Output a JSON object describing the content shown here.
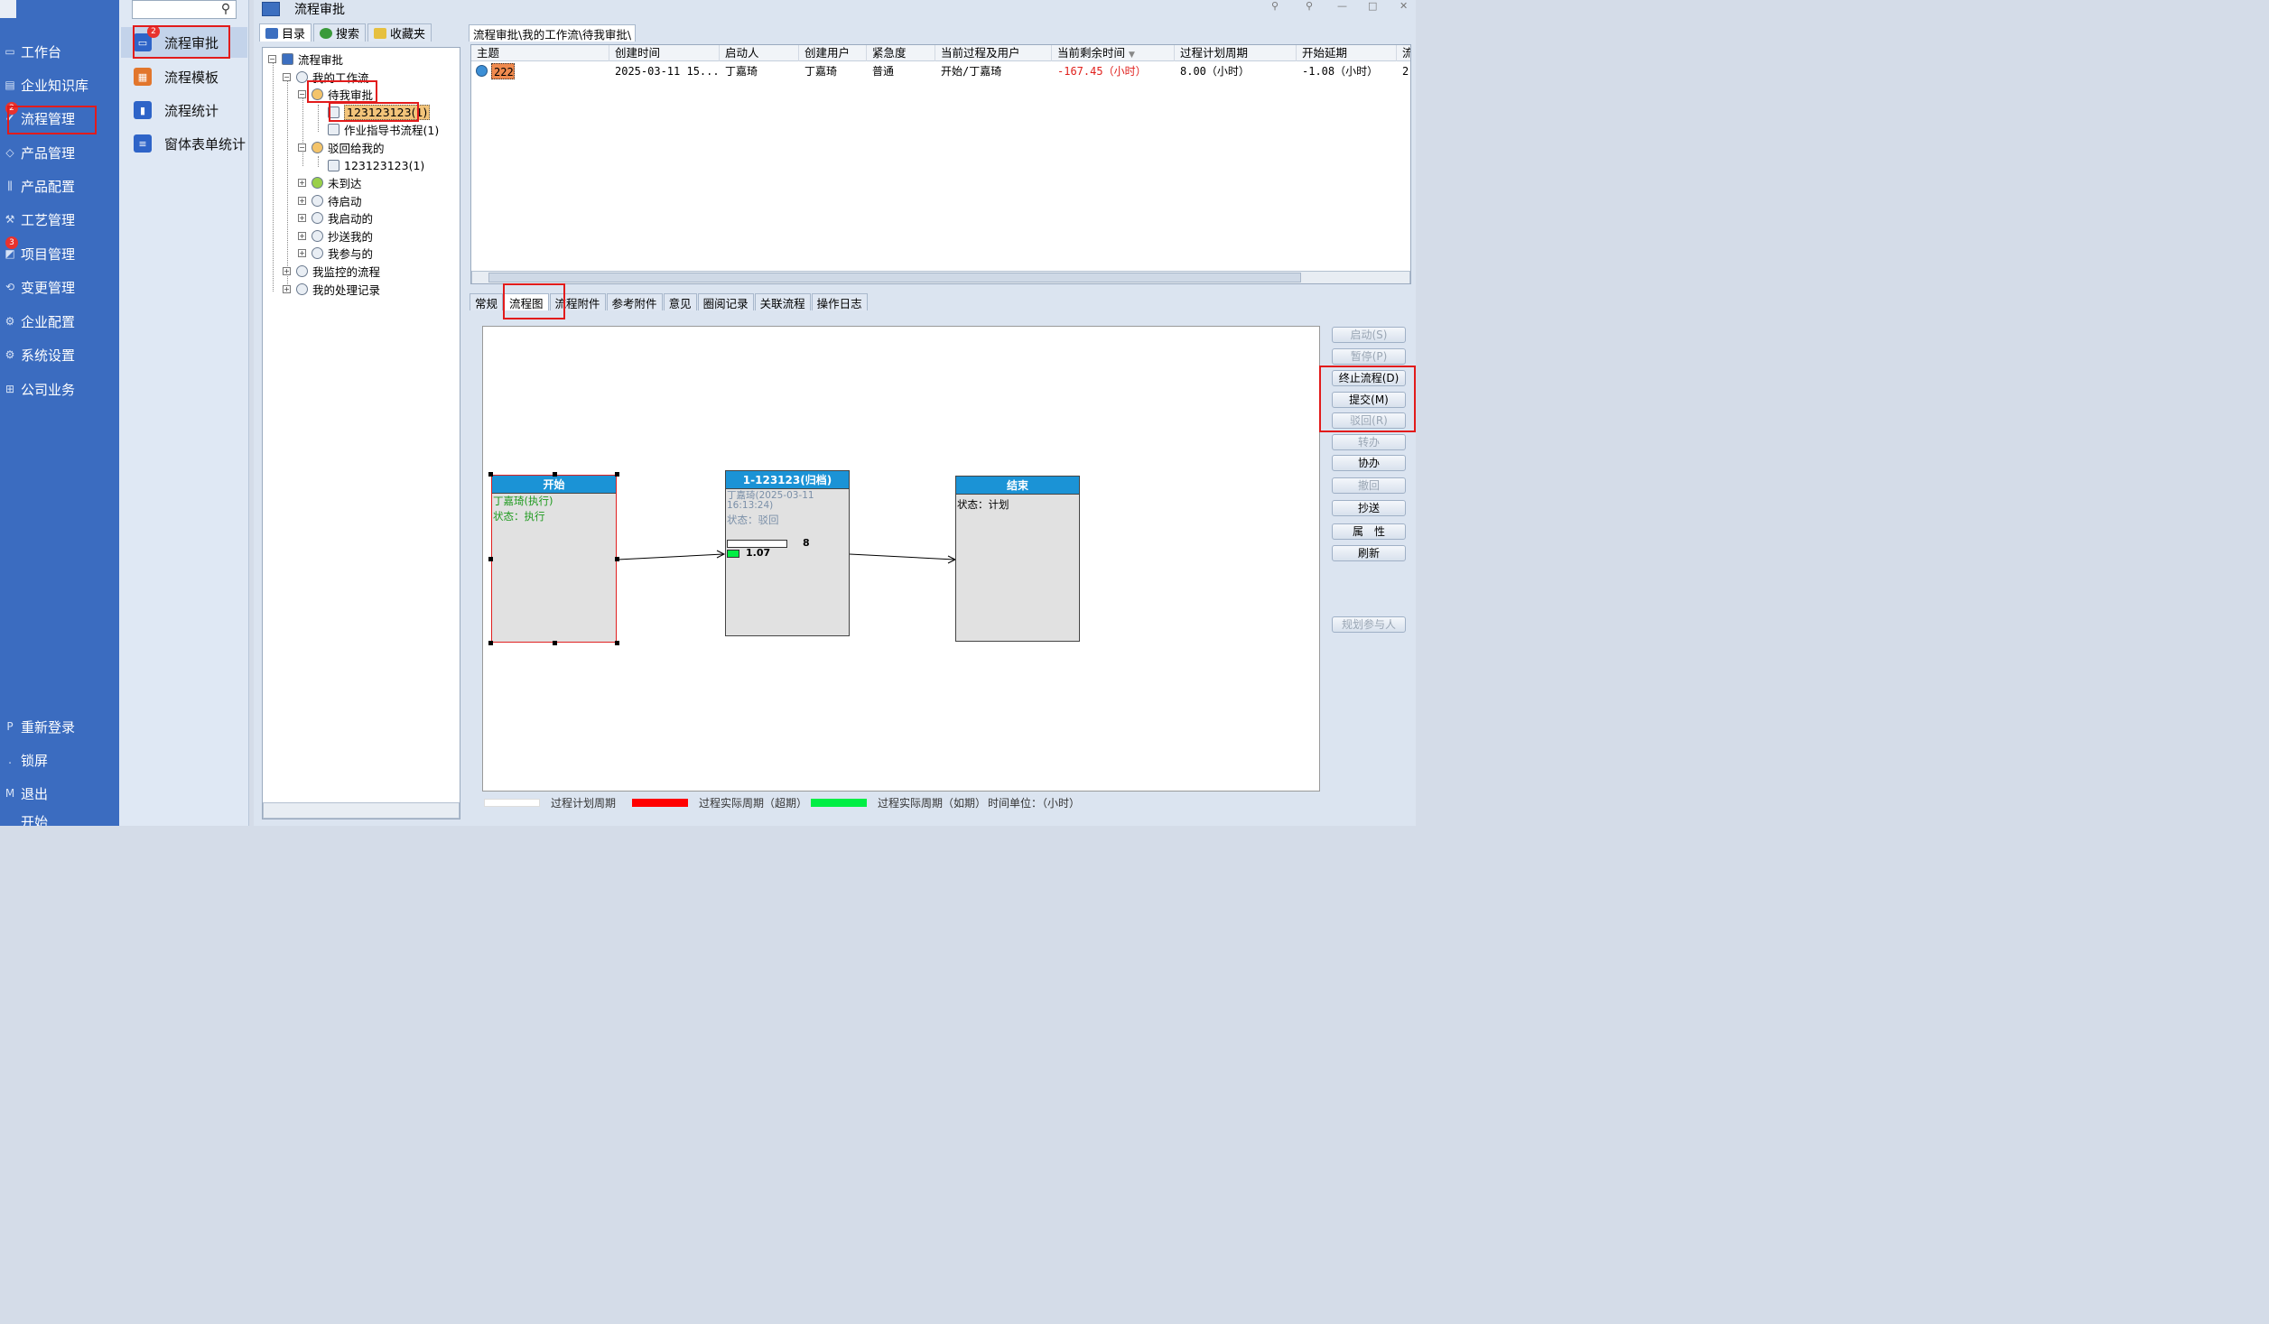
{
  "sidebar": {
    "items": [
      {
        "label": "工作台",
        "icon": "monitor-icon"
      },
      {
        "label": "企业知识库",
        "icon": "book-icon"
      },
      {
        "label": "流程管理",
        "icon": "check-icon",
        "badge": "2"
      },
      {
        "label": "产品管理",
        "icon": "box-icon"
      },
      {
        "label": "产品配置",
        "icon": "sliders-icon"
      },
      {
        "label": "工艺管理",
        "icon": "wrench-icon"
      },
      {
        "label": "项目管理",
        "icon": "project-icon",
        "badge": "3"
      },
      {
        "label": "变更管理",
        "icon": "change-icon"
      },
      {
        "label": "企业配置",
        "icon": "settings-icon"
      },
      {
        "label": "系统设置",
        "icon": "gear-icon"
      },
      {
        "label": "公司业务",
        "icon": "grid-icon"
      }
    ],
    "bottom": [
      {
        "label": "重新登录"
      },
      {
        "label": "锁屏"
      },
      {
        "label": "退出"
      },
      {
        "label": "开始"
      }
    ]
  },
  "subnav": {
    "items": [
      {
        "label": "流程审批",
        "badge": "2",
        "color": "#2e64c8"
      },
      {
        "label": "流程模板",
        "color": "#e2762c"
      },
      {
        "label": "流程统计",
        "color": "#2e64c8"
      },
      {
        "label": "窗体表单统计",
        "color": "#2e64c8"
      }
    ]
  },
  "window": {
    "title": "流程审批"
  },
  "left_tabs": [
    "目录",
    "搜索",
    "收藏夹"
  ],
  "tree": {
    "root": "流程审批",
    "my_workflow": "我的工作流",
    "pending": "待我审批",
    "pending_item1": "123123123(1)",
    "pending_item2": "作业指导书流程(1)",
    "rejected": "驳回给我的",
    "rejected_item1": "123123123(1)",
    "not_arrived": "未到达",
    "to_start": "待启动",
    "i_started": "我启动的",
    "cc_me": "抄送我的",
    "i_joined": "我参与的",
    "i_monitor": "我监控的流程",
    "my_records": "我的处理记录"
  },
  "breadcrumb": "流程审批\\我的工作流\\待我审批\\",
  "grid": {
    "columns": [
      "主题",
      "创建时间",
      "启动人",
      "创建用户",
      "紧急度",
      "当前过程及用户",
      "当前剩余时间",
      "过程计划周期",
      "开始延期",
      "流"
    ],
    "row": {
      "subject": "222",
      "created": "2025-03-11 15...",
      "starter": "丁嘉琦",
      "creator": "丁嘉琦",
      "urgency": "普通",
      "current": "开始/丁嘉琦",
      "remaining": "-167.45（小时）",
      "plan": "8.00（小时）",
      "delay": "-1.08（小时）",
      "extra": "2"
    },
    "remaining_color": "#e0201c"
  },
  "bottom_tabs": [
    "常规",
    "流程图",
    "流程附件",
    "参考附件",
    "意见",
    "圈阅记录",
    "关联流程",
    "操作日志"
  ],
  "diagram": {
    "start": {
      "title": "开始",
      "line1": "丁嘉琦(执行)",
      "line2": "状态：执行"
    },
    "mid": {
      "title": "1-123123(归档)",
      "line1": "丁嘉琦(2025-03-11",
      "line2": "16:13:24)",
      "line3": "状态：驳回",
      "plan": "8",
      "actual": "1.07"
    },
    "end": {
      "title": "结束",
      "line1": "状态：计划"
    }
  },
  "actions": {
    "start": "启动(S)",
    "pause": "暂停(P)",
    "terminate": "终止流程(D)",
    "submit": "提交(M)",
    "reject": "驳回(R)",
    "transfer": "转办",
    "assist": "协办",
    "withdraw": "撤回",
    "cc": "抄送",
    "props": "属　性",
    "refresh": "刷新",
    "plan": "规划参与人"
  },
  "legend": {
    "plan": "过程计划周期",
    "overdue": "过程实际周期（超期）",
    "ontime": "过程实际周期（如期）",
    "unit": "时间单位：（小时）",
    "colors": {
      "plan": "#ffffff",
      "overdue": "#ff0000",
      "ontime": "#00ee44"
    }
  }
}
